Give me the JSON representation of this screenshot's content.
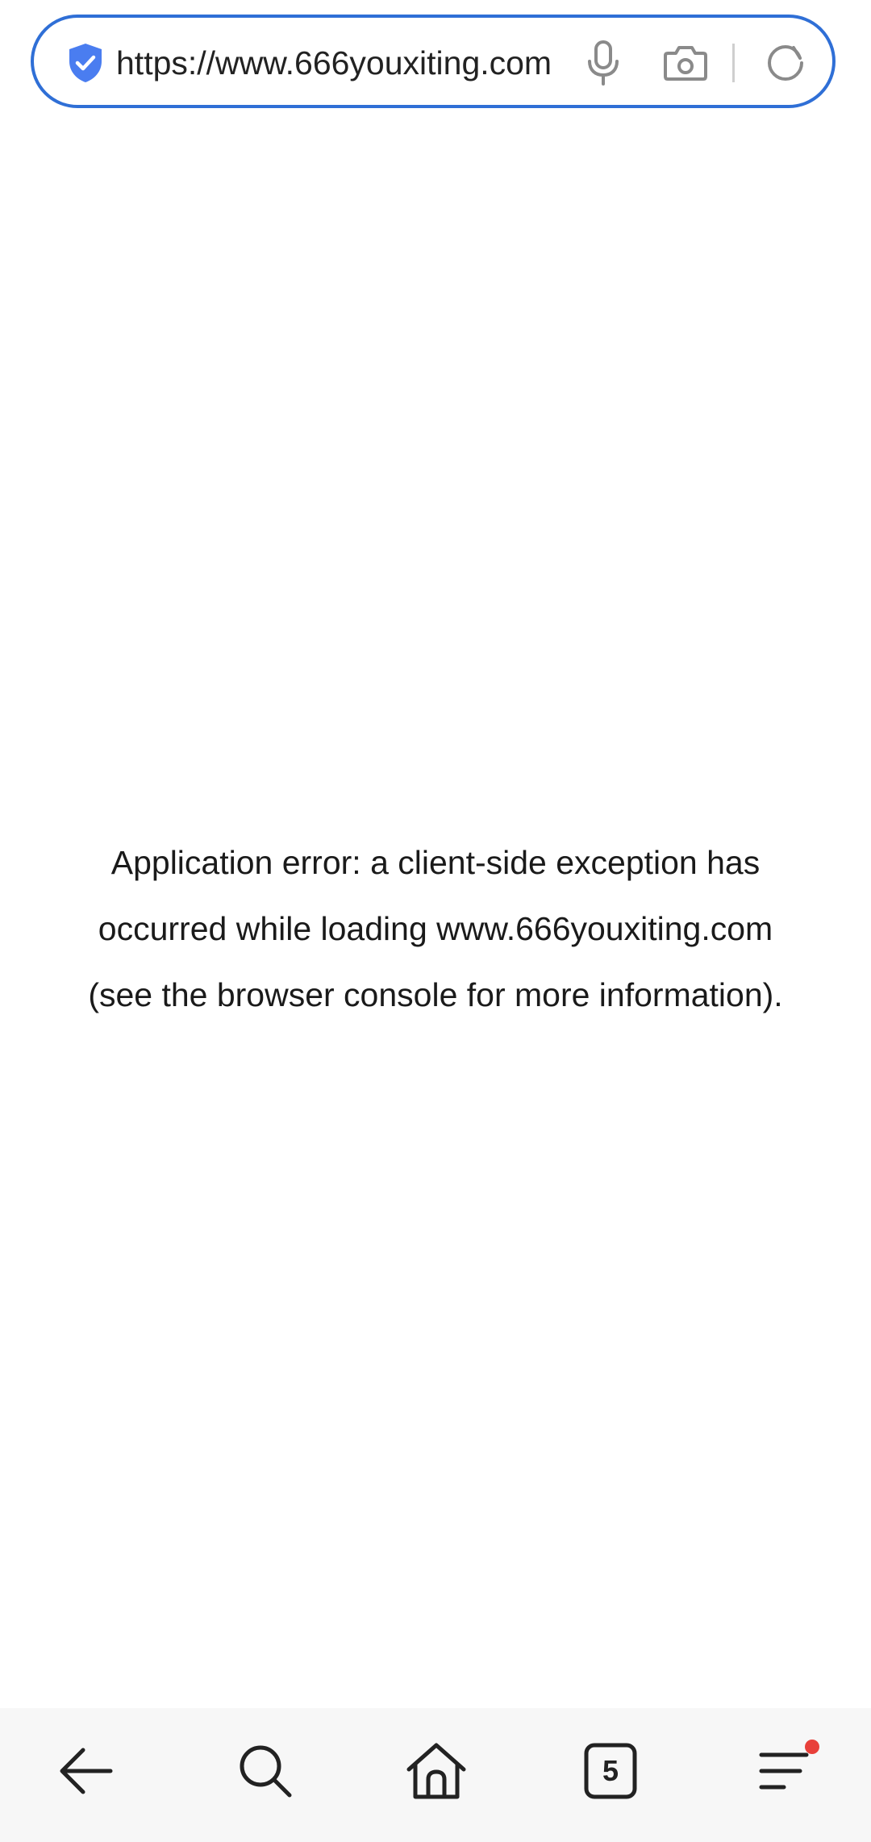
{
  "browser": {
    "url": "https://www.666youxiting.com",
    "tab_count": "5",
    "accent_color": "#2f6fd6",
    "icons": {
      "security": "shield-check-icon",
      "voice": "microphone-icon",
      "camera": "camera-icon",
      "reload": "reload-icon"
    }
  },
  "page": {
    "error_lines": [
      "Application error: a client-side exception has",
      "occurred while loading www.666youxiting.com",
      "(see the browser console for more information)."
    ]
  },
  "bottom_nav": {
    "items": [
      {
        "icon": "back-arrow-icon"
      },
      {
        "icon": "search-icon"
      },
      {
        "icon": "home-icon"
      },
      {
        "icon": "tabs-icon"
      },
      {
        "icon": "menu-icon"
      }
    ],
    "notification_color": "#e8403a"
  }
}
